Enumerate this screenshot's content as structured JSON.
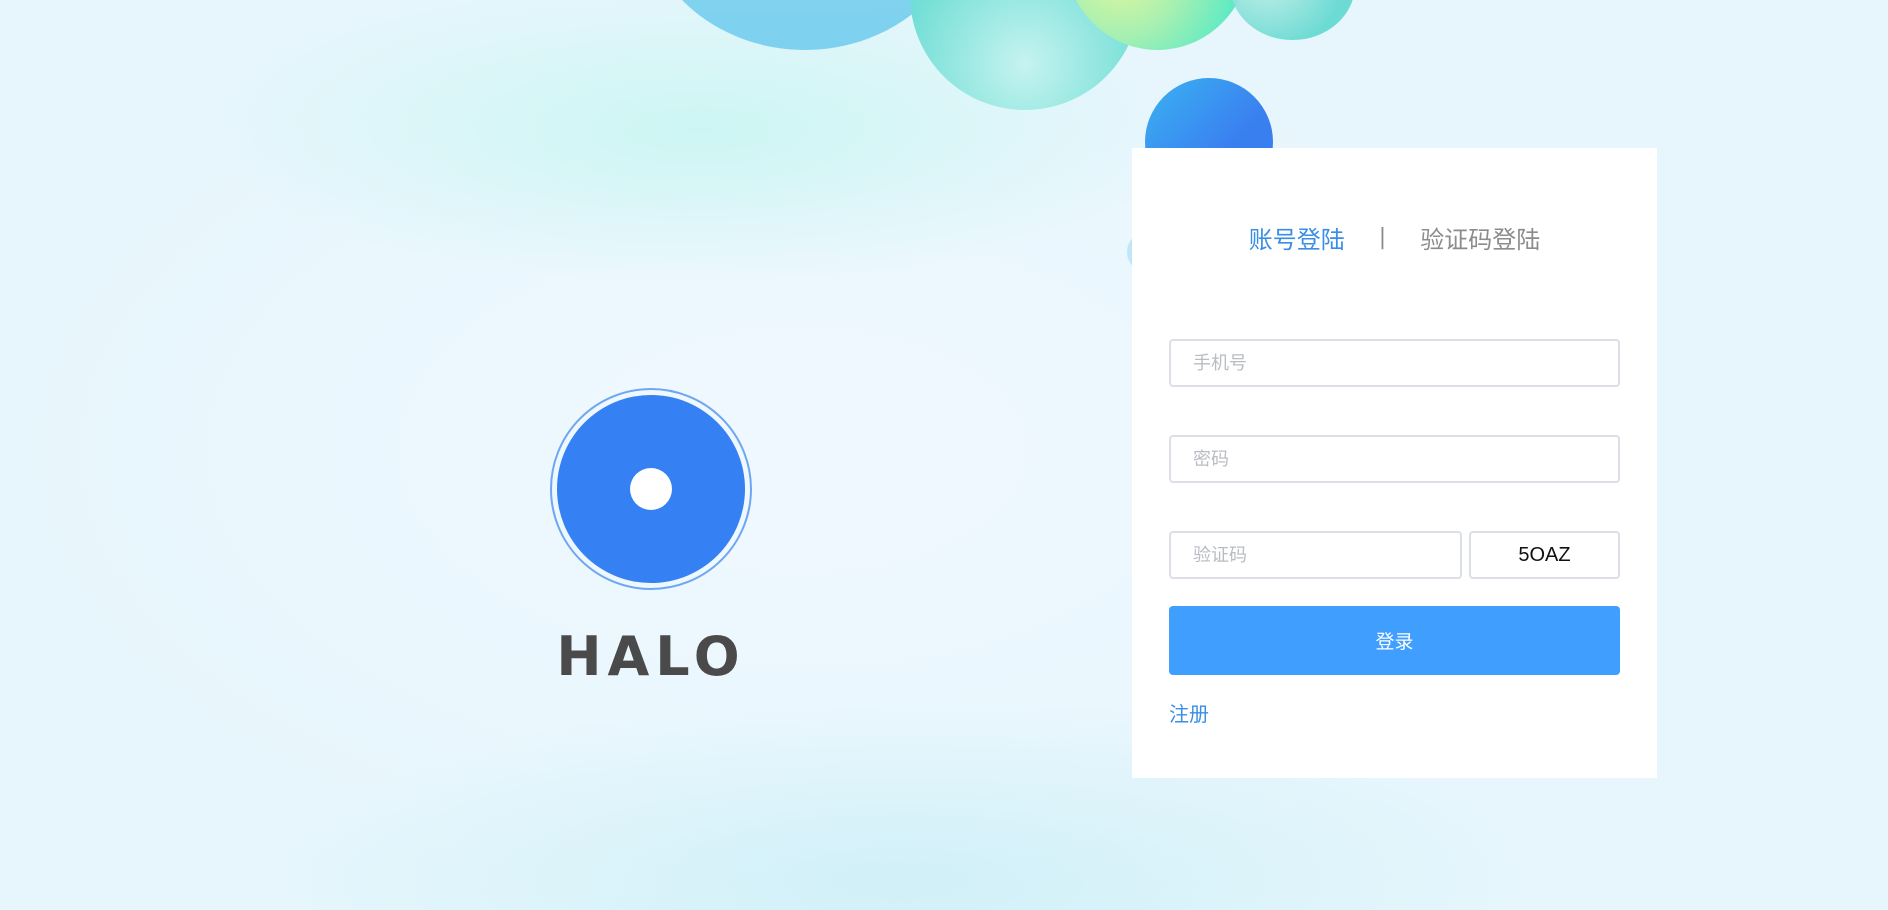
{
  "brand": {
    "name": "HALO"
  },
  "colors": {
    "accent": "#409eff",
    "logo": "#3580f3",
    "active_tab": "#3a8ee6"
  },
  "login": {
    "tabs": [
      {
        "label": "账号登陆",
        "active": true
      },
      {
        "label": "验证码登陆",
        "active": false
      }
    ],
    "separator": "|",
    "phone": {
      "placeholder": "手机号",
      "value": ""
    },
    "password": {
      "placeholder": "密码",
      "value": ""
    },
    "code": {
      "placeholder": "验证码",
      "value": ""
    },
    "captcha_text": "5OAZ",
    "submit_label": "登录",
    "register_label": "注册"
  }
}
